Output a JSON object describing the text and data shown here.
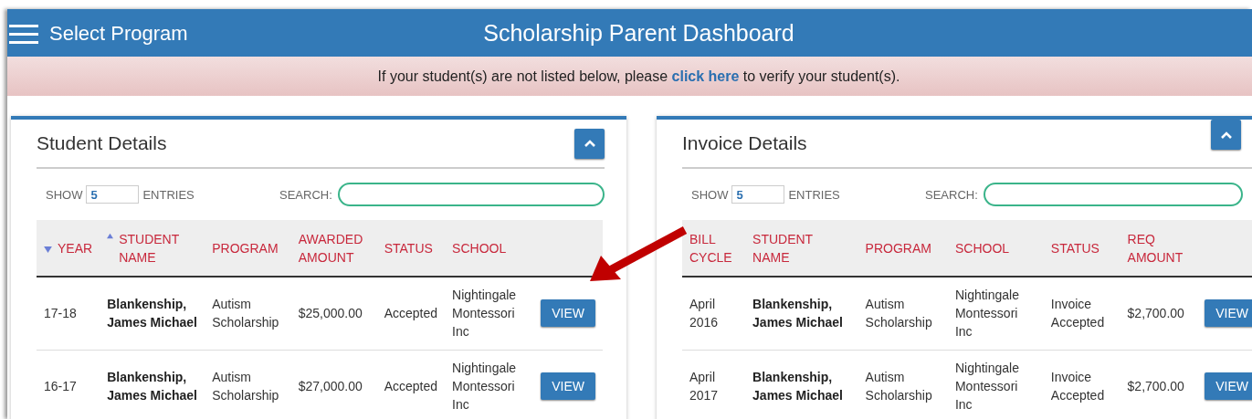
{
  "header": {
    "menu_label": "Select Program",
    "title": "Scholarship Parent Dashboard"
  },
  "notice": {
    "before": "If your student(s) are not listed below, please ",
    "link": "click here",
    "after": " to verify your student(s)."
  },
  "panels": [
    {
      "title": "Student Details",
      "show_label": "SHOW",
      "entries_value": "5",
      "entries_label": "ENTRIES",
      "search_label": "SEARCH:",
      "columns": [
        {
          "label": "YEAR",
          "sort_descending": true,
          "sort_ascending": false
        },
        {
          "label": "STUDENT NAME",
          "sort_descending": false,
          "sort_ascending": true
        },
        {
          "label": "PROGRAM",
          "sort_descending": false,
          "sort_ascending": false
        },
        {
          "label": "AWARDED AMOUNT",
          "sort_descending": false,
          "sort_ascending": false
        },
        {
          "label": "STATUS",
          "sort_descending": false,
          "sort_ascending": false
        },
        {
          "label": "SCHOOL",
          "sort_descending": false,
          "sort_ascending": false
        }
      ],
      "rows": [
        {
          "cells": [
            "17-18",
            "Blankenship, James Michael",
            "Autism Scholarship",
            "$25,000.00",
            "Accepted",
            "Nightingale Montessori Inc"
          ],
          "button": "VIEW"
        },
        {
          "cells": [
            "16-17",
            "Blankenship, James Michael",
            "Autism Scholarship",
            "$27,000.00",
            "Accepted",
            "Nightingale Montessori Inc"
          ],
          "button": "VIEW"
        }
      ]
    },
    {
      "title": "Invoice Details",
      "show_label": "SHOW",
      "entries_value": "5",
      "entries_label": "ENTRIES",
      "search_label": "SEARCH:",
      "columns": [
        {
          "label": "BILL CYCLE"
        },
        {
          "label": "STUDENT NAME"
        },
        {
          "label": "PROGRAM"
        },
        {
          "label": "SCHOOL"
        },
        {
          "label": "STATUS"
        },
        {
          "label": "REQ AMOUNT"
        }
      ],
      "rows": [
        {
          "cells": [
            "April 2016",
            "Blankenship, James Michael",
            "Autism Scholarship",
            "Nightingale Montessori Inc",
            "Invoice Accepted",
            "$2,700.00"
          ],
          "button": "VIEW"
        },
        {
          "cells": [
            "April 2017",
            "Blankenship, James Michael",
            "Autism Scholarship",
            "Nightingale Montessori Inc",
            "Invoice Accepted",
            "$2,700.00"
          ],
          "button": "VIEW"
        }
      ]
    }
  ]
}
